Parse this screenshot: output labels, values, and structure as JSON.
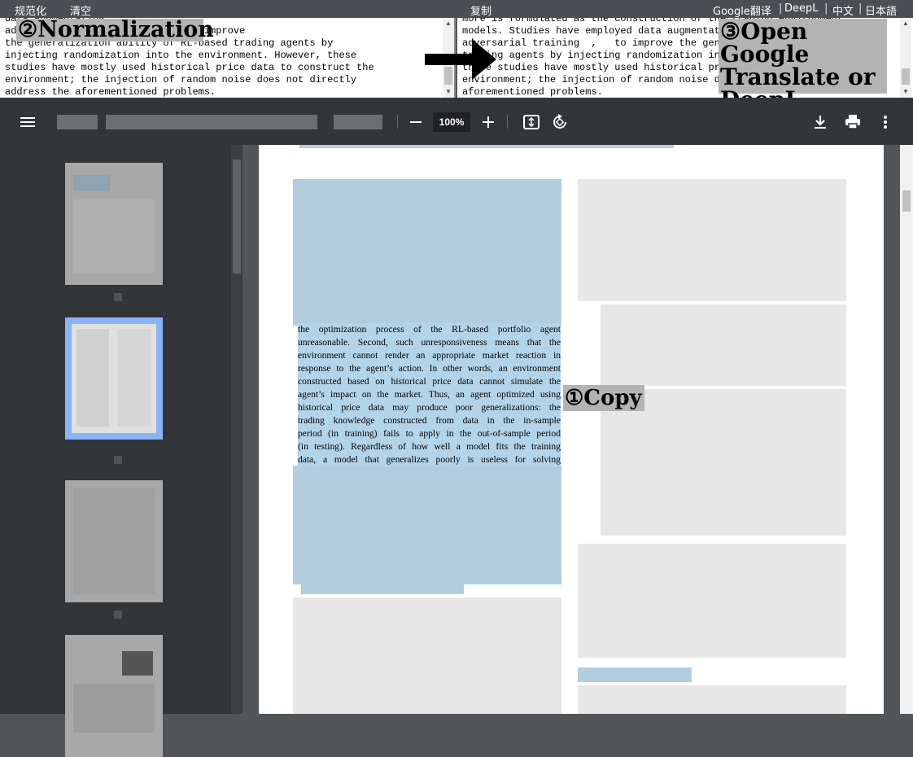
{
  "topbar": {
    "normalize": "规范化",
    "clear": "清空",
    "copy": "复制",
    "google": "Google翻译",
    "deepl": "DeepL",
    "lang_zh": "中文",
    "lang_ja": "日本語"
  },
  "left_pane": {
    "lines": [
      "data augmentation",
      "adversarial training [9], [11] to improve",
      "the generalization ability of RL-based trading agents by",
      "injecting randomization into the environment. However, these",
      "studies have mostly used historical price data to construct the",
      "environment; the injection of random noise does not directly",
      "address the aforementioned problems."
    ]
  },
  "right_pane": {
    "lines": [
      "more is formulated as the construction of the trading environment",
      "models. Studies have employed data augmentation",
      "adversarial training  ,   to improve the gene",
      "trading agents by injecting randomization int",
      "these studies have mostly used historical pri",
      "environment; the injection of random noise do",
      "aforementioned problems."
    ]
  },
  "annotations": {
    "normalization": "②Normalization",
    "open_translate": "③Open Google Translate or DeepL",
    "copy": "①Copy"
  },
  "pdf_toolbar": {
    "zoom": "100%",
    "icons": [
      "menu-icon",
      "zoom-out-icon",
      "zoom-in-icon",
      "fit-page-icon",
      "rotate-icon",
      "download-icon",
      "print-icon",
      "more-icon"
    ]
  },
  "document": {
    "selected_lines": [
      "the optimization process of the RL-based portfolio agent",
      "unreasonable. Second, such unresponsiveness means that the",
      "environment cannot render an appropriate market reaction in",
      "response to the agent’s action. In other words, an environment",
      "constructed based on historical price data cannot simulate the",
      "agent’s impact on the market. Thus, an agent optimized using",
      "historical price data may produce poor generalizations: the",
      "trading knowledge constructed from data in the in-sample",
      "period (in training) fails to apply in the out-of-sample period",
      "(in testing). Regardless of how well a model fits the training",
      "data, a model that generalizes poorly is useless for solving"
    ]
  },
  "colors": {
    "toolbar_bg": "#323639",
    "selection": "#b3d4e8",
    "annotation_bg": "#b3b3b3",
    "thumb_selected": "#8ab4f8"
  }
}
